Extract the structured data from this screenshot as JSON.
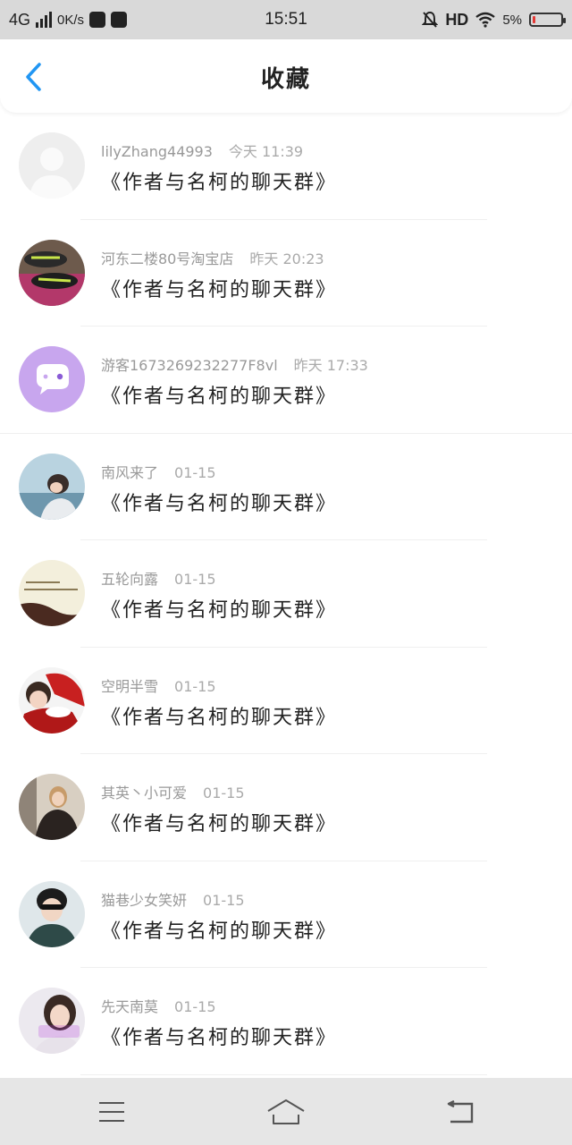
{
  "status_bar": {
    "network": "4G",
    "speed": "0K/s",
    "time": "15:51",
    "hd": "HD",
    "battery": "5%",
    "battery_level": 0.05
  },
  "header": {
    "title": "收藏",
    "back_icon": "chevron-left-icon"
  },
  "items": [
    {
      "name": "lilyZhang44993",
      "time": "今天 11:39",
      "message": "《作者与名柯的聊天群》",
      "avatar": "default-avatar"
    },
    {
      "name": "河东二楼80号淘宝店",
      "time": "昨天 20:23",
      "message": "《作者与名柯的聊天群》",
      "avatar": "shoes-photo"
    },
    {
      "name": "游客1673269232277F8vl",
      "time": "昨天 17:33",
      "message": "《作者与名柯的聊天群》",
      "avatar": "chat-bubble-avatar"
    },
    {
      "name": "南风来了",
      "time": "01-15",
      "message": "《作者与名柯的聊天群》",
      "avatar": "girl-photo"
    },
    {
      "name": "五轮向露",
      "time": "01-15",
      "message": "《作者与名柯的聊天群》",
      "avatar": "text-photo"
    },
    {
      "name": "空明半雪",
      "time": "01-15",
      "message": "《作者与名柯的聊天群》",
      "avatar": "santa-photo"
    },
    {
      "name": "其英丶小可爱",
      "time": "01-15",
      "message": "《作者与名柯的聊天群》",
      "avatar": "woman-photo"
    },
    {
      "name": "猫巷少女笑妍",
      "time": "01-15",
      "message": "《作者与名柯的聊天群》",
      "avatar": "boy-photo"
    },
    {
      "name": "先天南莫",
      "time": "01-15",
      "message": "《作者与名柯的聊天群》",
      "avatar": "sorry-photo"
    }
  ],
  "bottom_nav": {
    "menu_icon": "menu-icon",
    "home_icon": "home-icon",
    "back_icon": "back-arrow-icon"
  },
  "colors": {
    "accent": "#2196F3",
    "status_bar_bg": "#d9d9d9",
    "nav_bg": "#e6e6e6",
    "battery_low": "#e53935"
  }
}
